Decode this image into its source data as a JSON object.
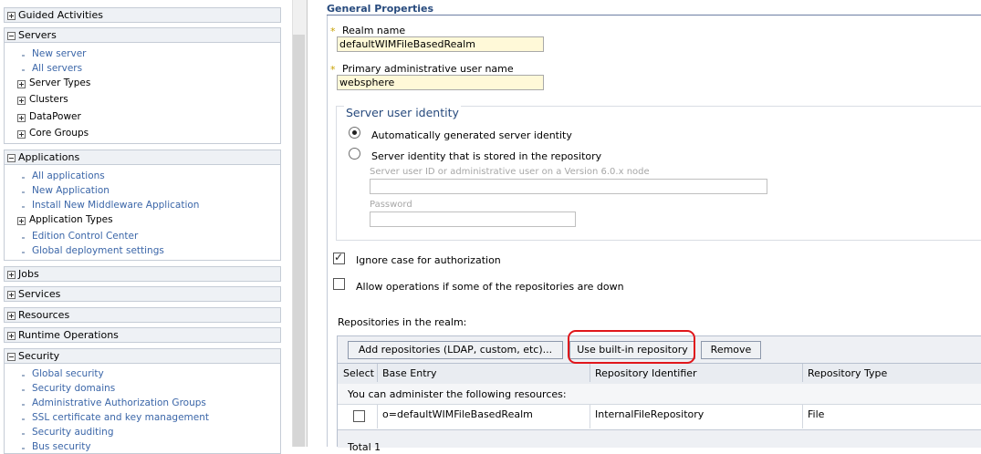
{
  "nav": {
    "sections": [
      {
        "label": "Guided Activities",
        "state": "collapsed"
      },
      {
        "label": "Servers",
        "state": "expanded",
        "items": [
          {
            "label": "New server",
            "kind": "link"
          },
          {
            "label": "All servers",
            "kind": "link"
          },
          {
            "label": "Server Types",
            "kind": "group"
          },
          {
            "label": "Clusters",
            "kind": "group"
          },
          {
            "label": "DataPower",
            "kind": "group"
          },
          {
            "label": "Core Groups",
            "kind": "group"
          }
        ]
      },
      {
        "label": "Applications",
        "state": "expanded",
        "items": [
          {
            "label": "All applications",
            "kind": "link"
          },
          {
            "label": "New Application",
            "kind": "link"
          },
          {
            "label": "Install New Middleware Application",
            "kind": "link"
          },
          {
            "label": "Application Types",
            "kind": "group"
          },
          {
            "label": "Edition Control Center",
            "kind": "link"
          },
          {
            "label": "Global deployment settings",
            "kind": "link"
          }
        ]
      },
      {
        "label": "Jobs",
        "state": "collapsed"
      },
      {
        "label": "Services",
        "state": "collapsed"
      },
      {
        "label": "Resources",
        "state": "collapsed"
      },
      {
        "label": "Runtime Operations",
        "state": "collapsed"
      },
      {
        "label": "Security",
        "state": "expanded",
        "items": [
          {
            "label": "Global security",
            "kind": "link"
          },
          {
            "label": "Security domains",
            "kind": "link"
          },
          {
            "label": "Administrative Authorization Groups",
            "kind": "link"
          },
          {
            "label": "SSL certificate and key management",
            "kind": "link"
          },
          {
            "label": "Security auditing",
            "kind": "link"
          },
          {
            "label": "Bus security",
            "kind": "link"
          }
        ]
      }
    ]
  },
  "main": {
    "section_title": "General Properties",
    "realm": {
      "required_mark": "*",
      "label": "Realm name",
      "value": "defaultWIMFileBasedRealm"
    },
    "admin_user": {
      "required_mark": "*",
      "label": "Primary administrative user name",
      "value": "websphere"
    },
    "server_identity": {
      "title": "Server user identity",
      "option_auto": {
        "label": "Automatically generated server identity",
        "selected": true
      },
      "option_repo": {
        "label": "Server identity that is stored in the repository",
        "selected": false
      },
      "user_id_label": "Server user ID or administrative user on a Version 6.0.x node",
      "user_id_value": "",
      "password_label": "Password",
      "password_value": ""
    },
    "ignore_case": {
      "label": "Ignore case for authorization",
      "checked": true
    },
    "allow_ops": {
      "label": "Allow operations if some of the repositories are down",
      "checked": false
    },
    "repositories": {
      "caption": "Repositories in the realm:",
      "buttons": {
        "add": "Add repositories (LDAP, custom, etc)...",
        "use_builtin": "Use built-in repository",
        "remove": "Remove"
      },
      "columns": [
        "Select",
        "Base Entry",
        "Repository Identifier",
        "Repository Type"
      ],
      "info_text": "You can administer the following resources:",
      "rows": [
        {
          "base_entry": "o=defaultWIMFileBasedRealm",
          "repository_identifier": "InternalFileRepository",
          "repository_type": "File",
          "selected": false
        }
      ],
      "total_label": "Total 1"
    }
  },
  "colors": {
    "link": "#3b66a8",
    "heading": "#274a7d",
    "highlight": "#e0161b",
    "field_bg": "#fff9d8"
  }
}
